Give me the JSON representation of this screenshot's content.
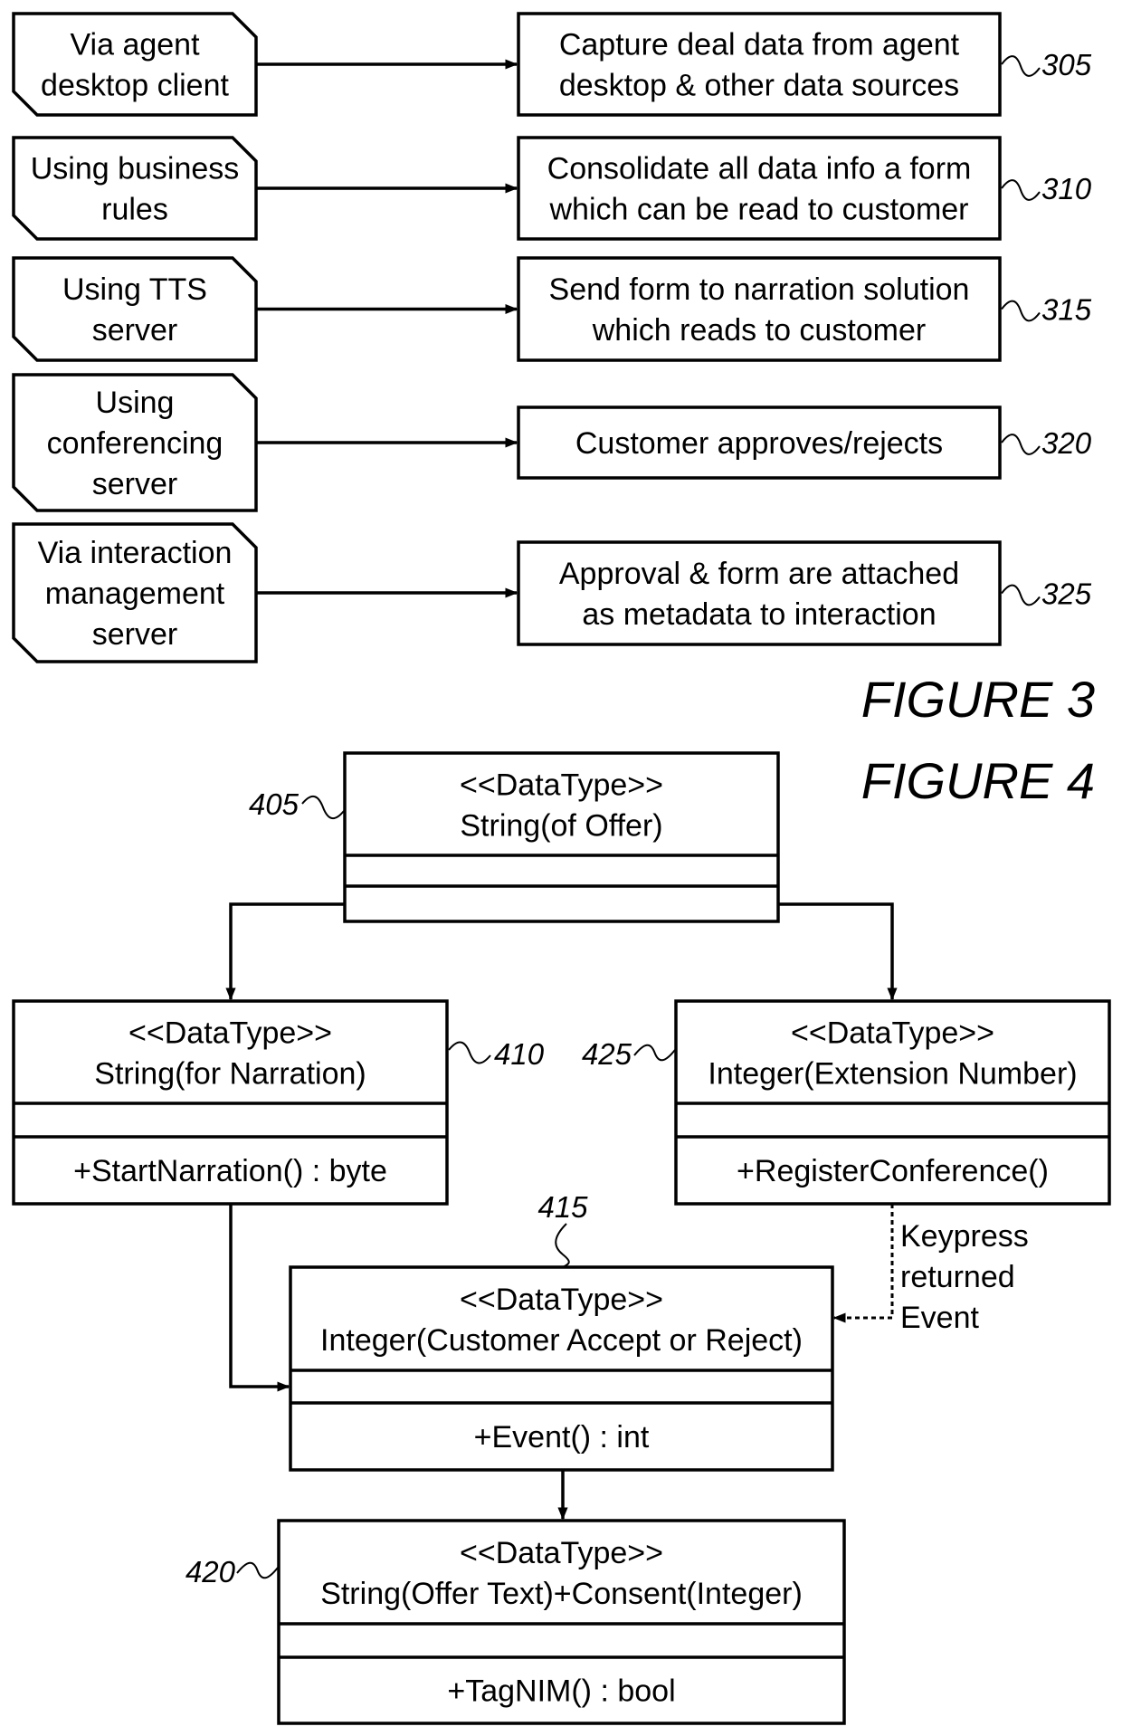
{
  "figure3": {
    "title": "FIGURE 3",
    "steps": [
      {
        "ref": "305",
        "means": [
          "Via agent",
          "desktop client"
        ],
        "action": [
          "Capture deal data from agent",
          "desktop & other data sources"
        ]
      },
      {
        "ref": "310",
        "means": [
          "Using business",
          "rules"
        ],
        "action": [
          "Consolidate all data info a form",
          "which can be read to customer"
        ]
      },
      {
        "ref": "315",
        "means": [
          "Using TTS",
          "server"
        ],
        "action": [
          "Send form to narration solution",
          "which reads to customer"
        ]
      },
      {
        "ref": "320",
        "means": [
          "Using",
          "conferencing",
          "server"
        ],
        "action": [
          "Customer approves/rejects"
        ]
      },
      {
        "ref": "325",
        "means": [
          "Via interaction",
          "management",
          "server"
        ],
        "action": [
          "Approval & form are attached",
          "as metadata to interaction"
        ]
      }
    ]
  },
  "figure4": {
    "title": "FIGURE 4",
    "classes": {
      "c405": {
        "ref": "405",
        "stereotype": "<<DataType>>",
        "name": "String(of Offer)",
        "attributes": "",
        "operations": ""
      },
      "c410": {
        "ref": "410",
        "stereotype": "<<DataType>>",
        "name": "String(for Narration)",
        "attributes": "",
        "operations": "+StartNarration() : byte"
      },
      "c425": {
        "ref": "425",
        "stereotype": "<<DataType>>",
        "name": "Integer(Extension Number)",
        "attributes": "",
        "operations": "+RegisterConference()"
      },
      "c415": {
        "ref": "415",
        "stereotype": "<<DataType>>",
        "name": "Integer(Customer Accept or Reject)",
        "attributes": "",
        "operations": "+Event() : int"
      },
      "c420": {
        "ref": "420",
        "stereotype": "<<DataType>>",
        "name": "String(Offer Text)+Consent(Integer)",
        "attributes": "",
        "operations": "+TagNIM() : bool"
      }
    },
    "dependency_note": [
      "Keypress",
      "returned",
      "Event"
    ]
  }
}
